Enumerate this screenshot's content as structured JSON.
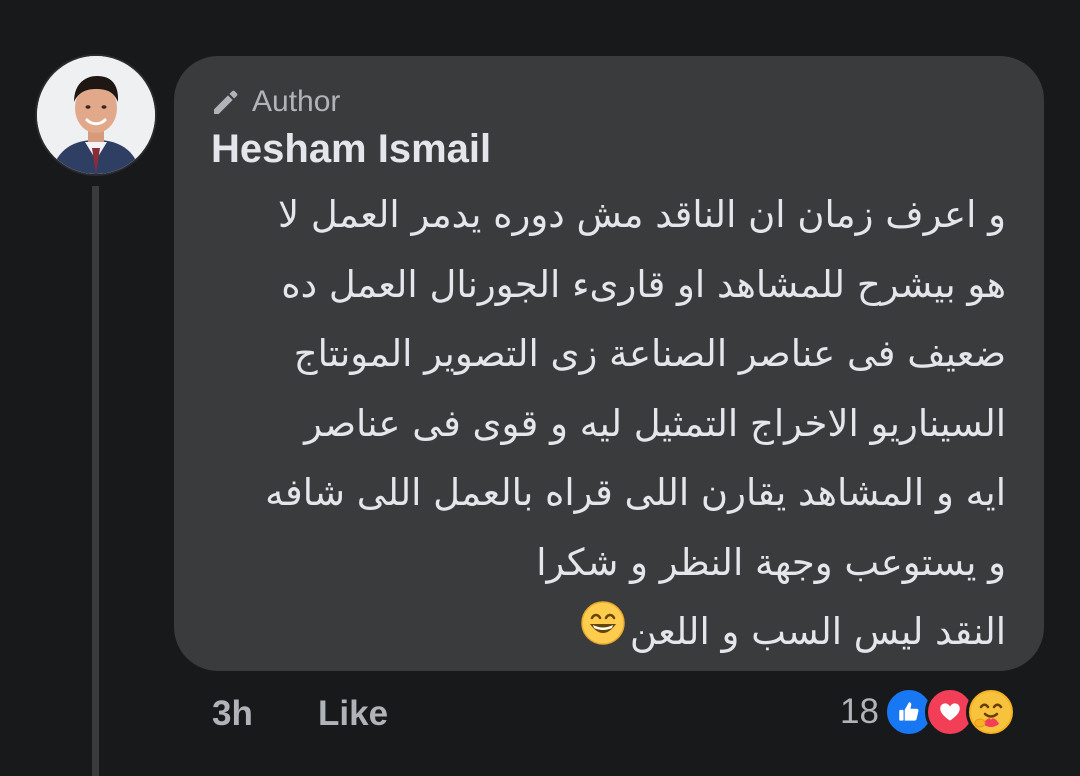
{
  "comment": {
    "author_badge": "Author",
    "author_name": "Hesham Ismail",
    "lines": [
      "و اعرف زمان ان الناقد مش دوره يدمر العمل لا",
      "هو بيشرح للمشاهد او قارىء الجورنال العمل ده",
      "ضعيف فى عناصر الصناعة زى التصوير المونتاج",
      "السيناريو الاخراج التمثيل ليه و قوى فى عناصر",
      "ايه و المشاهد يقارن اللى قراه بالعمل اللى شافه",
      "و يستوعب وجهة النظر و شكرا",
      "النقد ليس السب و اللعن"
    ],
    "emoji": "grinning-face-with-smiling-eyes"
  },
  "footer": {
    "time": "3h",
    "like_label": "Like",
    "reaction_count": "18",
    "reactions": [
      "like-reaction-icon",
      "love-reaction-icon",
      "care-reaction-icon"
    ]
  },
  "colors": {
    "background": "#18191a",
    "bubble": "#3a3b3c",
    "primary_text": "#e4e6eb",
    "secondary_text": "#b0b3b8",
    "like_blue": "#1877f2",
    "love_red": "#f33e58",
    "care_yellow": "#f7b125"
  }
}
